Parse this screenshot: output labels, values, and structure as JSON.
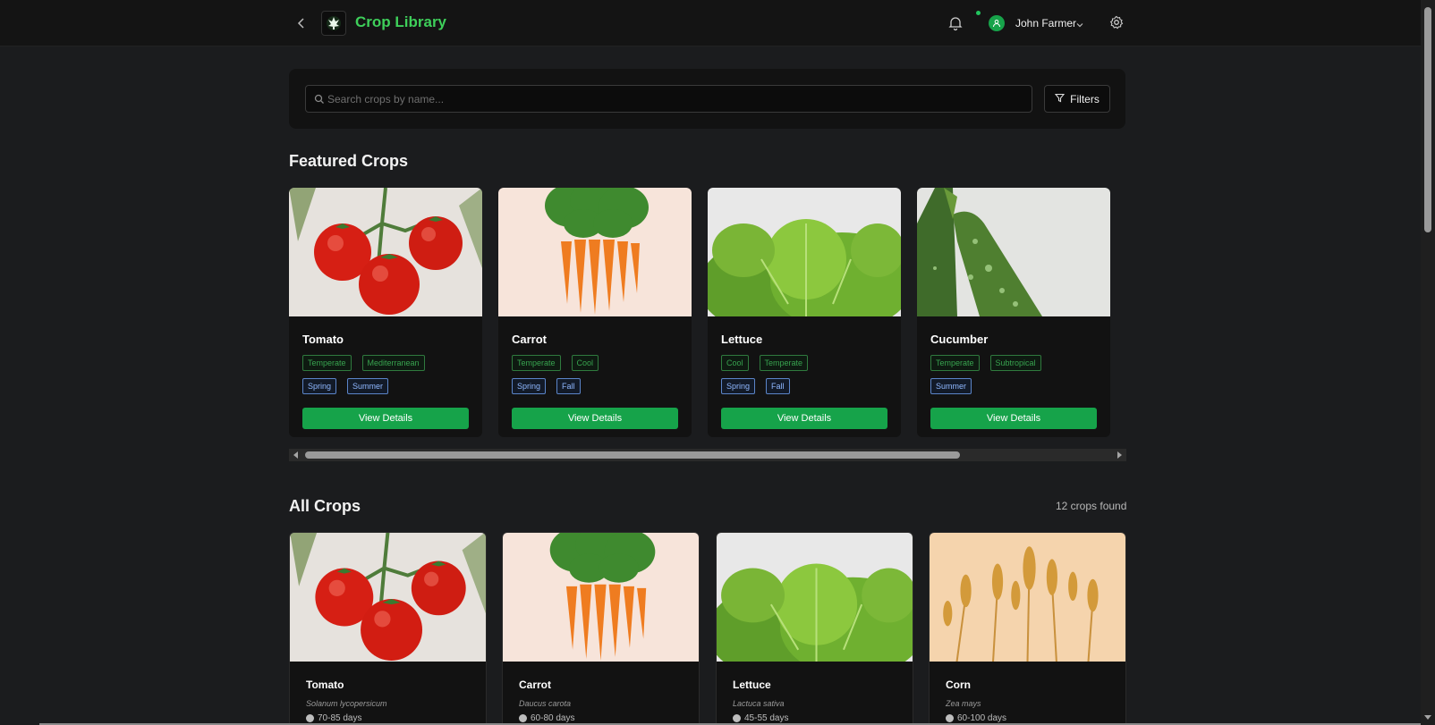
{
  "header": {
    "title": "Crop Library",
    "user_name": "John Farmer"
  },
  "search": {
    "placeholder": "Search crops by name...",
    "filters_label": "Filters"
  },
  "featured": {
    "title": "Featured Crops",
    "button_label": "View Details",
    "cards": [
      {
        "name": "Tomato",
        "climates": [
          "Temperate",
          "Mediterranean"
        ],
        "seasons": [
          "Spring",
          "Summer"
        ],
        "image": "tomato"
      },
      {
        "name": "Carrot",
        "climates": [
          "Temperate",
          "Cool"
        ],
        "seasons": [
          "Spring",
          "Fall"
        ],
        "image": "carrot"
      },
      {
        "name": "Lettuce",
        "climates": [
          "Cool",
          "Temperate"
        ],
        "seasons": [
          "Spring",
          "Fall"
        ],
        "image": "lettuce"
      },
      {
        "name": "Cucumber",
        "climates": [
          "Temperate",
          "Subtropical"
        ],
        "seasons": [
          "Summer"
        ],
        "image": "cucumber"
      }
    ]
  },
  "all": {
    "title": "All Crops",
    "count_label": "12 crops found",
    "cards": [
      {
        "name": "Tomato",
        "scientific": "Solanum lycopersicum",
        "days": "70-85 days",
        "image": "tomato"
      },
      {
        "name": "Carrot",
        "scientific": "Daucus carota",
        "days": "60-80 days",
        "image": "carrot"
      },
      {
        "name": "Lettuce",
        "scientific": "Lactuca sativa",
        "days": "45-55 days",
        "image": "lettuce"
      },
      {
        "name": "Corn",
        "scientific": "Zea mays",
        "days": "60-100 days",
        "image": "corn"
      }
    ]
  },
  "colors": {
    "accent": "#16a34a",
    "title_green": "#3ecf5a",
    "background": "#1b1c1e"
  },
  "icons": [
    "back-icon",
    "logo-icon",
    "bell-icon",
    "user-icon",
    "chevron-down-icon",
    "gear-icon",
    "search-icon",
    "filter-icon",
    "clock-icon"
  ]
}
